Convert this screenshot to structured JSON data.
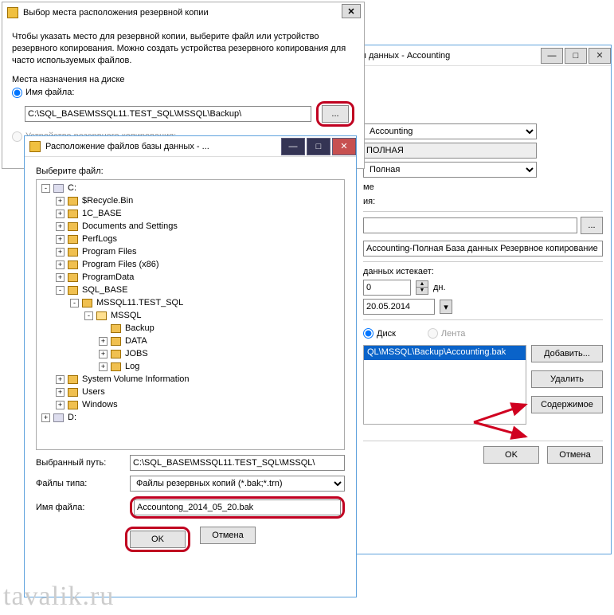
{
  "watermark": "tavalik.ru",
  "winC": {
    "title": "ы данных - Accounting",
    "db_value": "Accounting",
    "recovery_model": "ПОЛНАЯ",
    "backup_type": "Полная",
    "labels": {
      "me": "ме",
      "iya": "ия:"
    },
    "name_value": "Accounting-Полная База данных Резервное копирование",
    "expires_label": "данных истекает:",
    "days_value": "0",
    "days_unit": "дн.",
    "date_value": "20.05.2014",
    "dest_disk": "Диск",
    "dest_tape": "Лента",
    "file_path": "QL\\MSSQL\\Backup\\Accounting.bak",
    "btn_add": "Добавить...",
    "btn_del": "Удалить",
    "btn_content": "Содержимое",
    "ok": "OK",
    "cancel": "Отмена"
  },
  "winA": {
    "title": "Выбор места расположения резервной копии",
    "intro": "Чтобы указать место для резервной копии, выберите файл или устройство резервного копирования. Можно создать устройства резервного копирования для часто используемых файлов.",
    "dest_label": "Места назначения на диске",
    "radio_file": "Имя файла:",
    "path_value": "C:\\SQL_BASE\\MSSQL11.TEST_SQL\\MSSQL\\Backup\\",
    "browse": "...",
    "radio_device": "Устройство резервного копирования:"
  },
  "winB": {
    "title": "Расположение файлов базы данных - ...",
    "choose": "Выберите файл:",
    "tree": [
      {
        "d": 0,
        "t": "-",
        "k": "drive",
        "l": "C:"
      },
      {
        "d": 1,
        "t": "+",
        "k": "f",
        "l": "$Recycle.Bin"
      },
      {
        "d": 1,
        "t": "+",
        "k": "f",
        "l": "1C_BASE"
      },
      {
        "d": 1,
        "t": "+",
        "k": "f",
        "l": "Documents and Settings"
      },
      {
        "d": 1,
        "t": "+",
        "k": "f",
        "l": "PerfLogs"
      },
      {
        "d": 1,
        "t": "+",
        "k": "f",
        "l": "Program Files"
      },
      {
        "d": 1,
        "t": "+",
        "k": "f",
        "l": "Program Files (x86)"
      },
      {
        "d": 1,
        "t": "+",
        "k": "f",
        "l": "ProgramData"
      },
      {
        "d": 1,
        "t": "-",
        "k": "f",
        "l": "SQL_BASE"
      },
      {
        "d": 2,
        "t": "-",
        "k": "f",
        "l": "MSSQL11.TEST_SQL"
      },
      {
        "d": 3,
        "t": "-",
        "k": "fo",
        "l": "MSSQL"
      },
      {
        "d": 4,
        "t": "",
        "k": "f",
        "l": "Backup"
      },
      {
        "d": 4,
        "t": "+",
        "k": "f",
        "l": "DATA"
      },
      {
        "d": 4,
        "t": "+",
        "k": "f",
        "l": "JOBS"
      },
      {
        "d": 4,
        "t": "+",
        "k": "f",
        "l": "Log"
      },
      {
        "d": 1,
        "t": "+",
        "k": "f",
        "l": "System Volume Information"
      },
      {
        "d": 1,
        "t": "+",
        "k": "f",
        "l": "Users"
      },
      {
        "d": 1,
        "t": "+",
        "k": "f",
        "l": "Windows"
      },
      {
        "d": 0,
        "t": "+",
        "k": "drive",
        "l": "D:"
      }
    ],
    "sel_label": "Выбранный путь:",
    "sel_value": "C:\\SQL_BASE\\MSSQL11.TEST_SQL\\MSSQL\\",
    "type_label": "Файлы типа:",
    "type_value": "Файлы резервных копий (*.bak;*.trn)",
    "name_label": "Имя файла:",
    "name_value": "Accountong_2014_05_20.bak",
    "ok": "OK",
    "cancel": "Отмена"
  }
}
